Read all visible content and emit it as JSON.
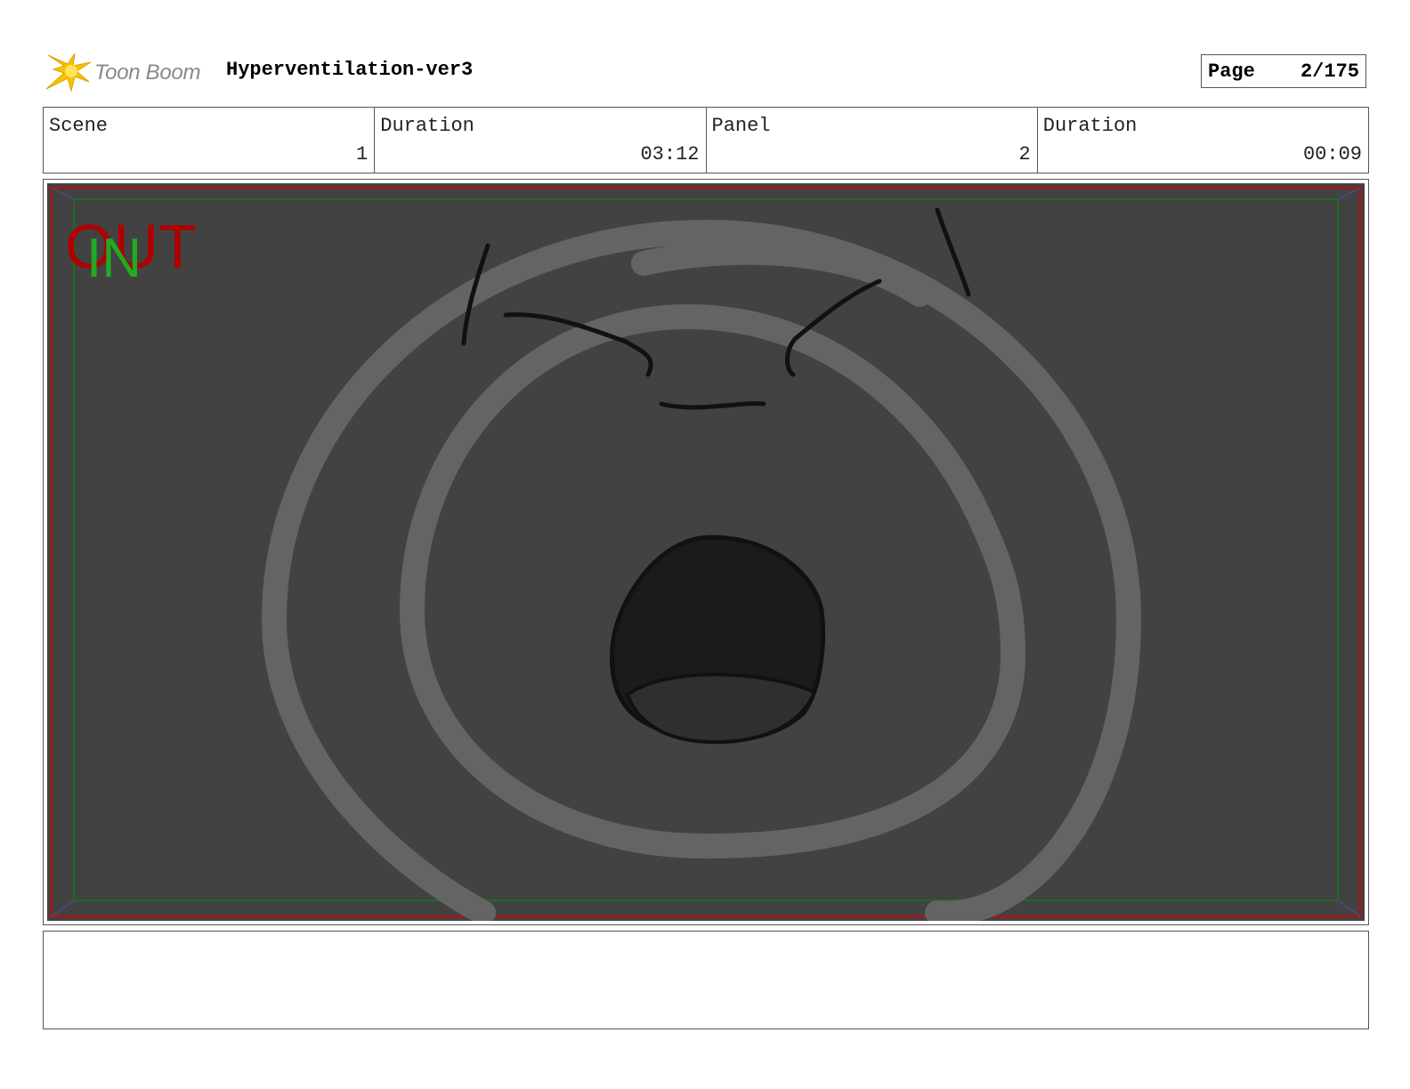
{
  "header": {
    "logo_text": "Toon Boom",
    "project_title": "Hyperventilation-ver3",
    "page_label": "Page",
    "page_value": "2/175"
  },
  "info": [
    {
      "label": "Scene",
      "value": "1"
    },
    {
      "label": "Duration",
      "value": "03:12"
    },
    {
      "label": "Panel",
      "value": "2"
    },
    {
      "label": "Duration",
      "value": "00:09"
    }
  ],
  "frame": {
    "out_label": "OUT",
    "in_label": "IN",
    "out_color": "#b00000",
    "in_color": "#22aa22",
    "background_color": "#424242",
    "ring_color": "#646464"
  },
  "notes": {
    "text": ""
  },
  "icons": {
    "logo": "toon-boom-starburst-icon"
  }
}
